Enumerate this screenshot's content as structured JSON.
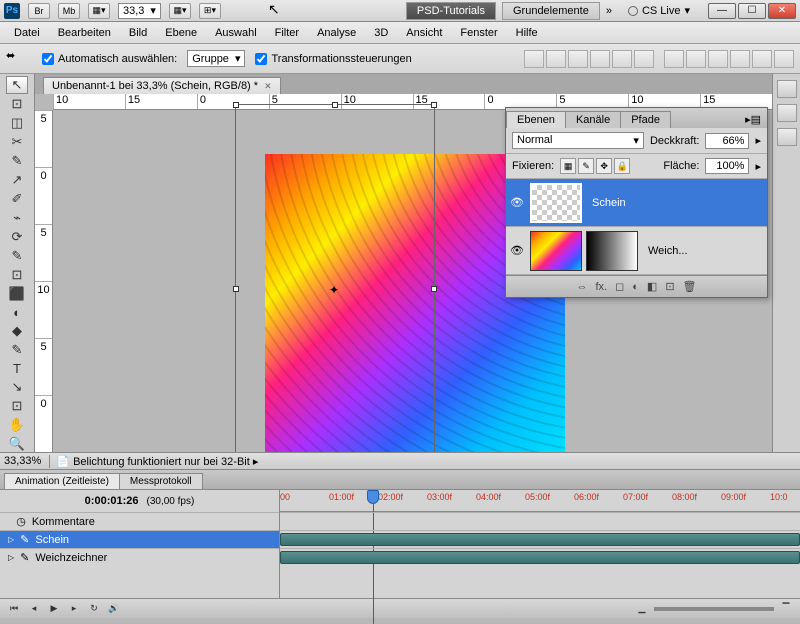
{
  "titlebar": {
    "app": "Ps",
    "badges": [
      "Br",
      "Mb"
    ],
    "zoom": "33,3",
    "breadcrumb_dark": "PSD-Tutorials",
    "breadcrumb_light": "Grundelemente",
    "chev": "»",
    "cslive": "CS Live"
  },
  "menu": [
    "Datei",
    "Bearbeiten",
    "Bild",
    "Ebene",
    "Auswahl",
    "Filter",
    "Analyse",
    "3D",
    "Ansicht",
    "Fenster",
    "Hilfe"
  ],
  "options": {
    "auto_select": "Automatisch auswählen:",
    "group": "Gruppe",
    "transform_controls": "Transformationssteuerungen"
  },
  "doc_tab": "Unbenannt-1 bei 33,3% (Schein, RGB/8) *",
  "ruler_h": [
    "10",
    "15",
    "0",
    "5",
    "10",
    "15",
    "0",
    "5",
    "10",
    "15"
  ],
  "ruler_v": [
    "5",
    "0",
    "5",
    "10",
    "5",
    "0"
  ],
  "layers": {
    "tabs": [
      "Ebenen",
      "Kanäle",
      "Pfade"
    ],
    "blend_mode": "Normal",
    "opacity_label": "Deckkraft:",
    "opacity": "66%",
    "lock_label": "Fixieren:",
    "fill_label": "Fläche:",
    "fill": "100%",
    "rows": [
      {
        "name": "Schein"
      },
      {
        "name": "Weich..."
      }
    ],
    "footer_icons": [
      "⇔",
      "fx.",
      "◻",
      "◐",
      "◧",
      "⊡",
      "🗑"
    ]
  },
  "status": {
    "zoom": "33,33%",
    "msg": "Belichtung funktioniert nur bei 32-Bit"
  },
  "animation": {
    "tabs": [
      "Animation (Zeitleiste)",
      "Messprotokoll"
    ],
    "timecode": "0:00:01:26",
    "fps": "(30,00 fps)",
    "time_labels": [
      "00",
      "01:00f",
      "02:00f",
      "03:00f",
      "04:00f",
      "05:00f",
      "06:00f",
      "07:00f",
      "08:00f",
      "09:00f",
      "10:0"
    ],
    "tracks": [
      {
        "icon": "◷",
        "name": "Kommentare"
      },
      {
        "icon": "✎",
        "name": "Schein",
        "sel": true
      },
      {
        "icon": "✎",
        "name": "Weichzeichner"
      }
    ]
  },
  "tool_icons": [
    "↖",
    "⊡",
    "◫",
    "✂",
    "✎",
    "↗",
    "✐",
    "⌁",
    "⟳",
    "✎",
    "⊡",
    "⬛",
    "◐",
    "◆",
    "✎",
    "T",
    "↘",
    "⊡",
    "✋",
    "🔍"
  ]
}
